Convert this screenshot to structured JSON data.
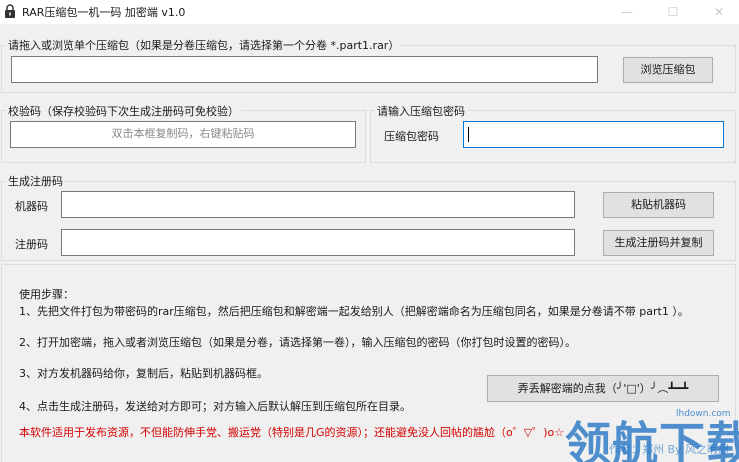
{
  "window": {
    "title": "RAR压缩包一机一码  加密端 v1.0",
    "controls": {
      "minimize": "—",
      "maximize": "☐",
      "close": "✕"
    }
  },
  "archive_group": {
    "label": "请拖入或浏览单个压缩包（如果是分卷压缩包，请选择第一个分卷 *.part1.rar）",
    "path_value": "",
    "browse_button": "浏览压缩包"
  },
  "checksum_group": {
    "label": "校验码（保存校验码下次生成注册码可免校验）",
    "placeholder": "双击本框复制码，右键粘贴码"
  },
  "password_group": {
    "label": "请输入压缩包密码",
    "field_label": "压缩包密码",
    "value": ""
  },
  "register_group": {
    "label": "生成注册码",
    "machine_label": "机器码",
    "machine_value": "",
    "paste_button": "粘贴机器码",
    "regcode_label": "注册码",
    "regcode_value": "",
    "generate_button": "生成注册码并复制"
  },
  "steps": {
    "heading": "使用步骤：",
    "items": [
      "1、先把文件打包为带密码的rar压缩包，然后把压缩包和解密端一起发给别人（把解密端命名为压缩包同名，如果是分卷请不带 part1 ）。",
      "2、打开加密端，拖入或者浏览压缩包（如果是分卷，请选择第一卷），输入压缩包的密码（你打包时设置的密码）。",
      "3、对方发机器码给你，复制后，粘贴到机器码框。",
      "4、点击生成注册码，发送给对方即可；对方输入后默认解压到压缩包所在目录。"
    ],
    "notice": "本软件适用于发布资源，不但能防伸手党、搬运党（特别是几G的资源）；还能避免没人回帖的尴尬（o゜▽゜)o☆",
    "fun_button": "弄丢解密端的点我（╯'□'）╯︵┻━┻"
  },
  "watermark": {
    "logo": "领航下载",
    "url": "lhdown.com",
    "credit": "作者：郑州  By 风之暇想"
  },
  "colors": {
    "window_bg": "#f0f0f0",
    "focus_border": "#0078d7",
    "notice_red": "#d40000",
    "watermark_blue": "#2273c4"
  }
}
